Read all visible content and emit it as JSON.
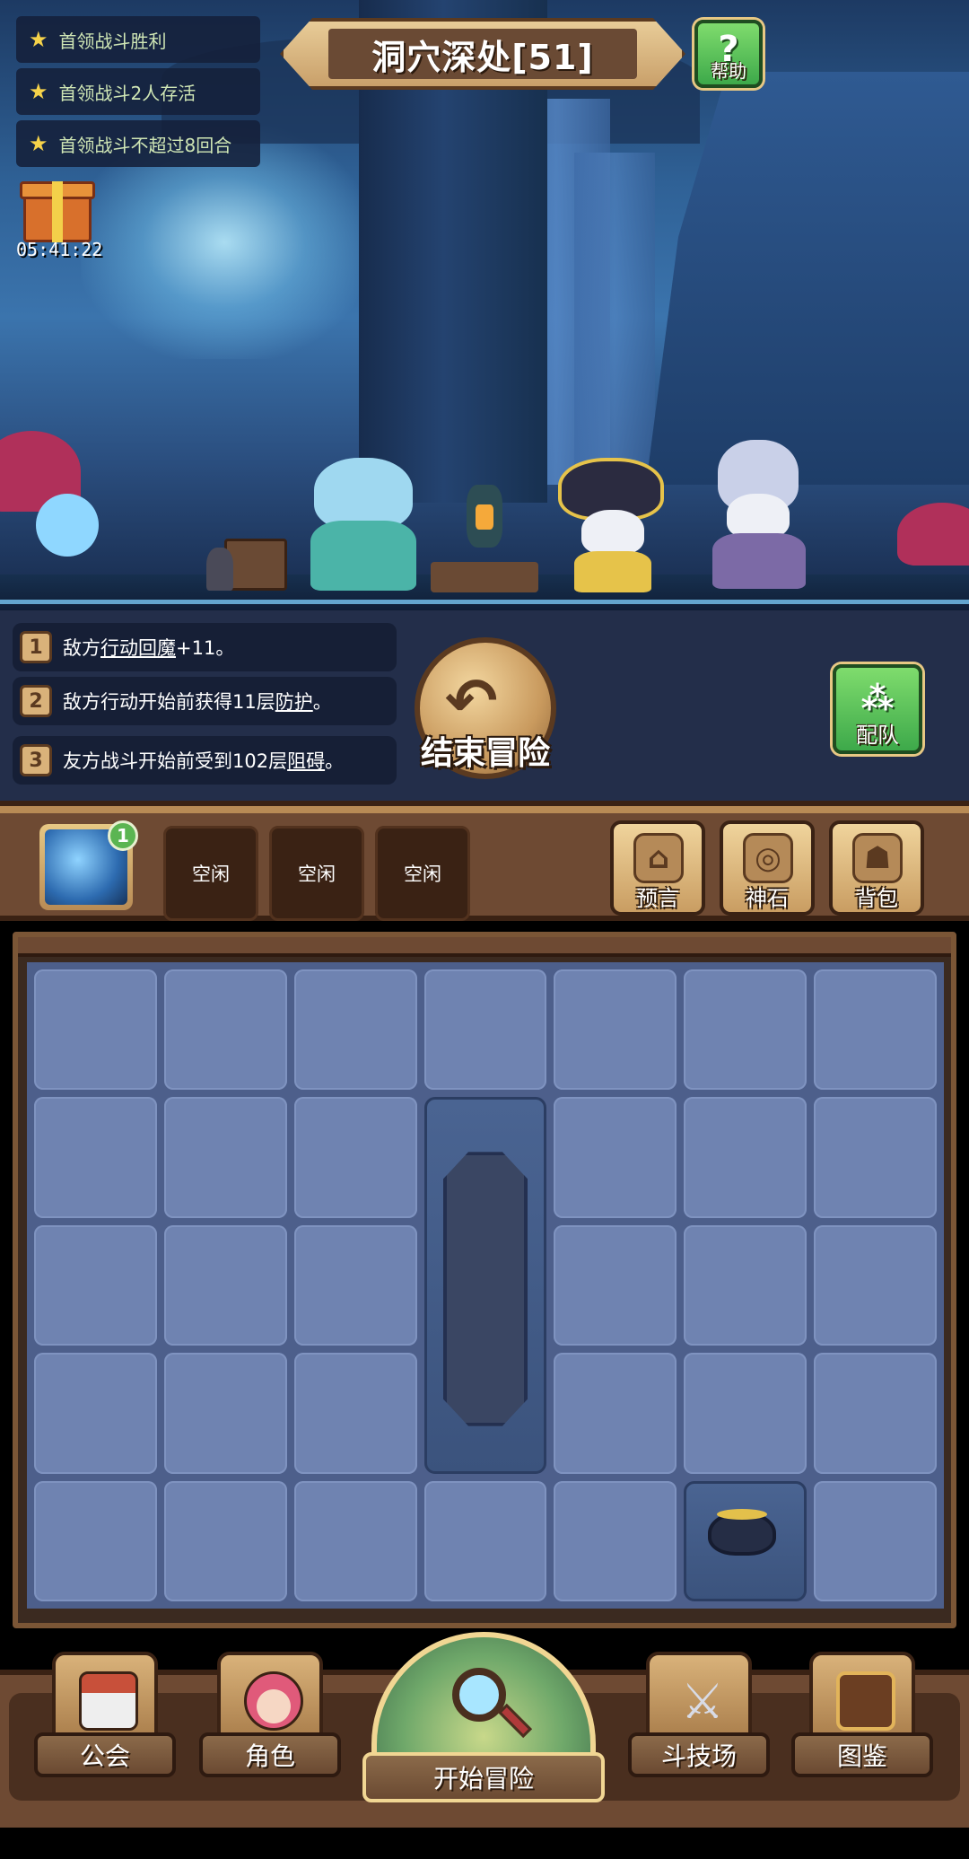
{
  "header": {
    "title": "洞穴深处[51]",
    "help_label": "帮助",
    "help_glyph": "?"
  },
  "quests": [
    {
      "icon": "star-icon",
      "text": "首领战斗胜利"
    },
    {
      "icon": "star-icon",
      "text": "首领战斗2人存活"
    },
    {
      "icon": "star-icon",
      "text": "首领战斗不超过8回合"
    }
  ],
  "gift": {
    "timer": "05:41:22"
  },
  "buffs": [
    {
      "num": "1",
      "pre": "敌方",
      "link": "行动回魔",
      "post": "+11。"
    },
    {
      "num": "2",
      "pre": "敌方行动开始前获得11层",
      "link": "防护",
      "post": "。"
    },
    {
      "num": "3",
      "pre": "友方战斗开始前受到102层",
      "link": "阻碍",
      "post": "。"
    }
  ],
  "end_button": {
    "label": "结束冒险"
  },
  "team_button": {
    "label": "配队"
  },
  "toolbar": {
    "crystal_badge": "1",
    "idle_slots": [
      "空闲",
      "空闲",
      "空闲"
    ],
    "prophecy_label": "预言",
    "godstone_label": "神石",
    "backpack_label": "背包"
  },
  "grid": {
    "cols": 7,
    "rows": 5
  },
  "bottom_nav": {
    "guild": "公会",
    "character": "角色",
    "start_adventure": "开始冒险",
    "arena": "斗技场",
    "codex": "图鉴"
  },
  "colors": {
    "quest_text": "#cfe6b5",
    "star": "#f6d34a",
    "wood": "#6e4a33",
    "grid_cell": "#6f83b1",
    "green_button": "#3da94a"
  }
}
